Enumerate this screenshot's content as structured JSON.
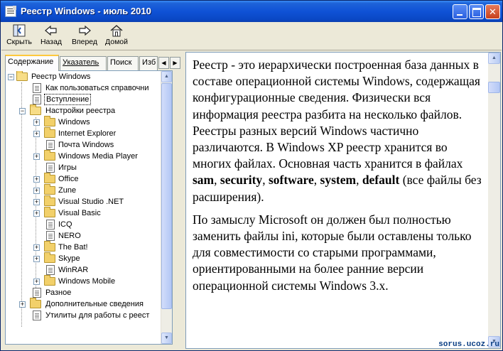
{
  "window": {
    "title": "Реестр Windows - июль 2010"
  },
  "toolbar": {
    "hide_label": "Скрыть",
    "back_label": "Назад",
    "forward_label": "Вперед",
    "home_label": "Домой"
  },
  "nav_tabs": {
    "contents": "Содержание",
    "index": "Указатель",
    "search": "Поиск",
    "favorites_partial": "Изб"
  },
  "tree": {
    "root": "Реестр Windows",
    "how_to_use": "Как пользоваться справочни",
    "intro": "Вступление",
    "settings": "Настройки реестра",
    "settings_items": [
      "Windows",
      "Internet Explorer",
      "Почта Windows",
      "Windows Media Player",
      "Игры",
      "Office",
      "Zune",
      "Visual Studio .NET",
      "Visual Basic",
      "ICQ",
      "NERO",
      "The Bat!",
      "Skype",
      "WinRAR",
      "Windows Mobile"
    ],
    "misc": "Разное",
    "additional": "Дополнительные сведения",
    "utilities": "Утилиты для работы с реест"
  },
  "article": {
    "p1_a": "Реестр - это иерархически построенная база данных в составе операционной системы Windows, содержащая конфигурационные сведения. Физически вся информация реестра разбита на несколько файлов. Реестры разных версий Windows частично различаются. В Windows XP реестр хранится во многих файлах. Основная часть хранится в файлах ",
    "file1": "sam",
    "file2": "security",
    "file3": "software",
    "file4": "system",
    "file5": "default",
    "sep": ", ",
    "p1_end": " (все файлы без расширения).",
    "p2": "По замыслу Microsoft он должен был полностью заменить файлы ini, которые были оставлены только для совместимости со старыми программами, ориентированными на более ранние версии операционной системы Windows 3.x."
  },
  "watermark": "sorus.ucoz.ru",
  "colors": {
    "titlebar": "#0f52d6",
    "window_bg": "#ece9d8",
    "tab_highlight": "#ffc83c",
    "folder": "#f2d06a"
  }
}
